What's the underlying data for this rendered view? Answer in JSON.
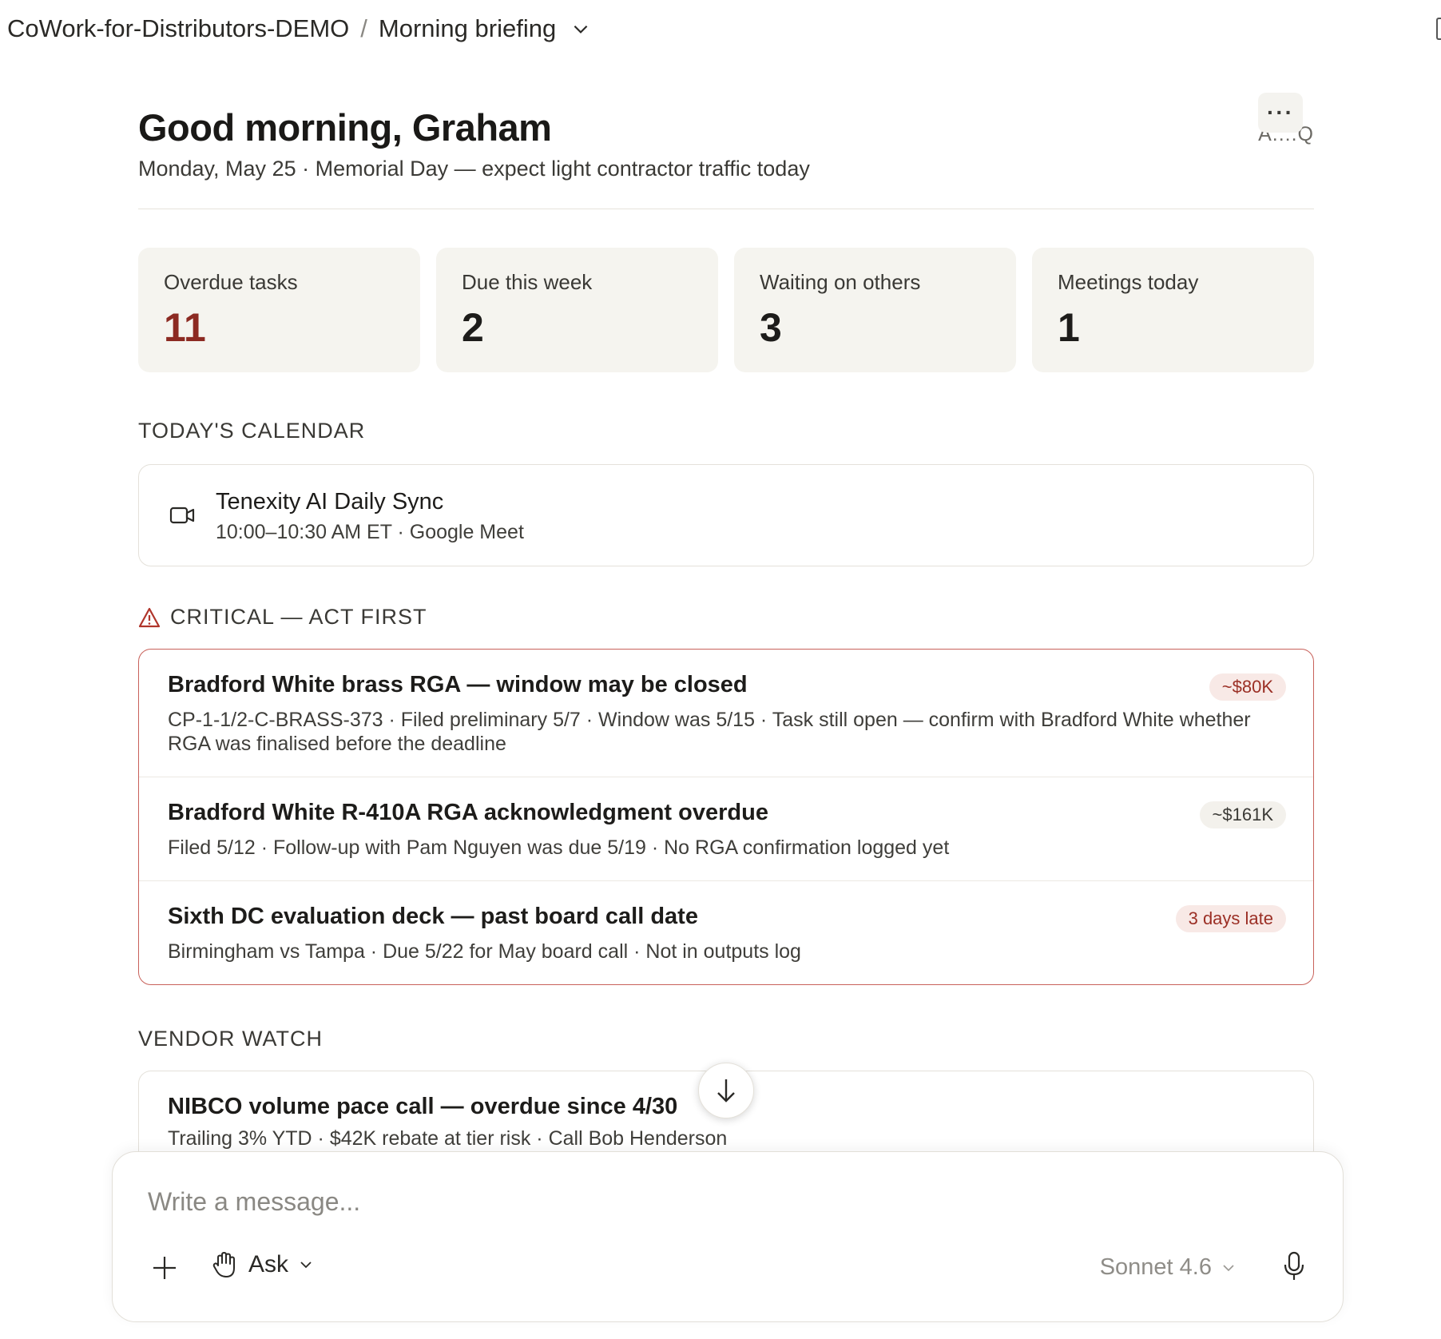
{
  "breadcrumb": {
    "workspace": "CoWork-for-Distributors-DEMO",
    "separator": "/",
    "page": "Morning briefing"
  },
  "header": {
    "greeting": "Good morning, Graham",
    "subline": "Monday, May 25 · Memorial Day — expect light contractor traffic today",
    "more_label": "···",
    "corner_text": "A..:.Q"
  },
  "stats": [
    {
      "label": "Overdue tasks",
      "value": "11"
    },
    {
      "label": "Due this week",
      "value": "2"
    },
    {
      "label": "Waiting on others",
      "value": "3"
    },
    {
      "label": "Meetings today",
      "value": "1"
    }
  ],
  "calendar": {
    "title": "TODAY'S CALENDAR",
    "event": {
      "name": "Tenexity AI Daily Sync",
      "details": "10:00–10:30 AM ET · Google Meet"
    }
  },
  "critical": {
    "title": "CRITICAL — ACT FIRST",
    "items": [
      {
        "title": "Bradford White brass RGA — window may be closed",
        "badge": "~$80K",
        "desc": "CP-1-1/2-C-BRASS-373 · Filed preliminary 5/7 · Window was 5/15 · Task still open — confirm with Bradford White whether RGA was finalised before the deadline"
      },
      {
        "title": "Bradford White R-410A RGA acknowledgment overdue",
        "badge": "~$161K",
        "desc": "Filed 5/12 · Follow-up with Pam Nguyen was due 5/19 · No RGA confirmation logged yet"
      },
      {
        "title": "Sixth DC evaluation deck — past board call date",
        "badge": "3 days late",
        "desc": "Birmingham vs Tampa · Due 5/22 for May board call · Not in outputs log"
      }
    ]
  },
  "vendor": {
    "title": "VENDOR WATCH",
    "item": {
      "title": "NIBCO volume pace call — overdue since 4/30",
      "desc": "Trailing 3% YTD · $42K rebate at tier risk · Call Bob Henderson"
    }
  },
  "composer": {
    "placeholder": "Write a message...",
    "mode": "Ask",
    "model": "Sonnet 4.6"
  },
  "colors": {
    "accent_red": "#8c2a22",
    "critical_border": "#c8615a",
    "card_bg": "#f5f4ef"
  }
}
